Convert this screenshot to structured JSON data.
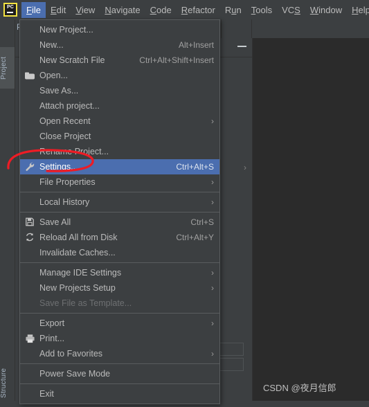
{
  "window": {
    "logo_text": "PC",
    "tool_tabs": {
      "project": "Project",
      "structure": "Structure"
    },
    "editor_hidden_label": "Py"
  },
  "menubar": {
    "items": [
      {
        "label": "File",
        "mnemonic": "F",
        "active": true
      },
      {
        "label": "Edit",
        "mnemonic": "E",
        "active": false
      },
      {
        "label": "View",
        "mnemonic": "V",
        "active": false
      },
      {
        "label": "Navigate",
        "mnemonic": "N",
        "active": false
      },
      {
        "label": "Code",
        "mnemonic": "C",
        "active": false
      },
      {
        "label": "Refactor",
        "mnemonic": "R",
        "active": false
      },
      {
        "label": "Run",
        "mnemonic": "u",
        "active": false
      },
      {
        "label": "Tools",
        "mnemonic": "T",
        "active": false
      },
      {
        "label": "VCS",
        "mnemonic": "S",
        "active": false
      },
      {
        "label": "Window",
        "mnemonic": "W",
        "active": false
      },
      {
        "label": "Help",
        "mnemonic": "H",
        "active": false
      }
    ]
  },
  "file_menu": {
    "items": [
      {
        "kind": "item",
        "label": "New Project...",
        "shortcut": "",
        "icon": "",
        "submenu": false,
        "selected": false,
        "disabled": false
      },
      {
        "kind": "item",
        "label": "New...",
        "shortcut": "Alt+Insert",
        "icon": "",
        "submenu": false,
        "selected": false,
        "disabled": false
      },
      {
        "kind": "item",
        "label": "New Scratch File",
        "shortcut": "Ctrl+Alt+Shift+Insert",
        "icon": "",
        "submenu": false,
        "selected": false,
        "disabled": false
      },
      {
        "kind": "item",
        "label": "Open...",
        "shortcut": "",
        "icon": "folder-icon",
        "submenu": false,
        "selected": false,
        "disabled": false
      },
      {
        "kind": "item",
        "label": "Save As...",
        "shortcut": "",
        "icon": "",
        "submenu": false,
        "selected": false,
        "disabled": false
      },
      {
        "kind": "item",
        "label": "Attach project...",
        "shortcut": "",
        "icon": "",
        "submenu": false,
        "selected": false,
        "disabled": false
      },
      {
        "kind": "item",
        "label": "Open Recent",
        "shortcut": "",
        "icon": "",
        "submenu": true,
        "selected": false,
        "disabled": false
      },
      {
        "kind": "item",
        "label": "Close Project",
        "shortcut": "",
        "icon": "",
        "submenu": false,
        "selected": false,
        "disabled": false
      },
      {
        "kind": "item",
        "label": "Rename Project...",
        "shortcut": "",
        "icon": "",
        "submenu": false,
        "selected": false,
        "disabled": false
      },
      {
        "kind": "item",
        "label": "Settings...",
        "shortcut": "Ctrl+Alt+S",
        "icon": "wrench-icon",
        "submenu": false,
        "selected": true,
        "disabled": false
      },
      {
        "kind": "item",
        "label": "File Properties",
        "shortcut": "",
        "icon": "",
        "submenu": true,
        "selected": false,
        "disabled": false
      },
      {
        "kind": "sep"
      },
      {
        "kind": "item",
        "label": "Local History",
        "shortcut": "",
        "icon": "",
        "submenu": true,
        "selected": false,
        "disabled": false
      },
      {
        "kind": "sep"
      },
      {
        "kind": "item",
        "label": "Save All",
        "shortcut": "Ctrl+S",
        "icon": "save-icon",
        "submenu": false,
        "selected": false,
        "disabled": false
      },
      {
        "kind": "item",
        "label": "Reload All from Disk",
        "shortcut": "Ctrl+Alt+Y",
        "icon": "reload-icon",
        "submenu": false,
        "selected": false,
        "disabled": false
      },
      {
        "kind": "item",
        "label": "Invalidate Caches...",
        "shortcut": "",
        "icon": "",
        "submenu": false,
        "selected": false,
        "disabled": false
      },
      {
        "kind": "sep"
      },
      {
        "kind": "item",
        "label": "Manage IDE Settings",
        "shortcut": "",
        "icon": "",
        "submenu": true,
        "selected": false,
        "disabled": false
      },
      {
        "kind": "item",
        "label": "New Projects Setup",
        "shortcut": "",
        "icon": "",
        "submenu": true,
        "selected": false,
        "disabled": false
      },
      {
        "kind": "item",
        "label": "Save File as Template...",
        "shortcut": "",
        "icon": "",
        "submenu": false,
        "selected": false,
        "disabled": true
      },
      {
        "kind": "sep"
      },
      {
        "kind": "item",
        "label": "Export",
        "shortcut": "",
        "icon": "",
        "submenu": true,
        "selected": false,
        "disabled": false
      },
      {
        "kind": "item",
        "label": "Print...",
        "shortcut": "",
        "icon": "print-icon",
        "submenu": false,
        "selected": false,
        "disabled": false
      },
      {
        "kind": "item",
        "label": "Add to Favorites",
        "shortcut": "",
        "icon": "",
        "submenu": true,
        "selected": false,
        "disabled": false
      },
      {
        "kind": "sep"
      },
      {
        "kind": "item",
        "label": "Power Save Mode",
        "shortcut": "",
        "icon": "",
        "submenu": false,
        "selected": false,
        "disabled": false
      },
      {
        "kind": "sep"
      },
      {
        "kind": "item",
        "label": "Exit",
        "shortcut": "",
        "icon": "",
        "submenu": false,
        "selected": false,
        "disabled": false
      }
    ]
  },
  "annotation": {
    "shape": "red-ellipse-highlight",
    "color": "#ee1c25",
    "target": "Settings..."
  },
  "watermark": {
    "text": "CSDN @夜月信郎"
  },
  "colors": {
    "menu_bg": "#3c3f41",
    "editor_bg": "#2b2b2b",
    "selection_blue": "#4b6eaf",
    "text": "#bbbbbb",
    "disabled_text": "#6e7072",
    "accent_yellow": "#f4e342",
    "annotation_red": "#ee1c25",
    "row_tan": "#6e6242",
    "row_blue": "#123a5f"
  }
}
